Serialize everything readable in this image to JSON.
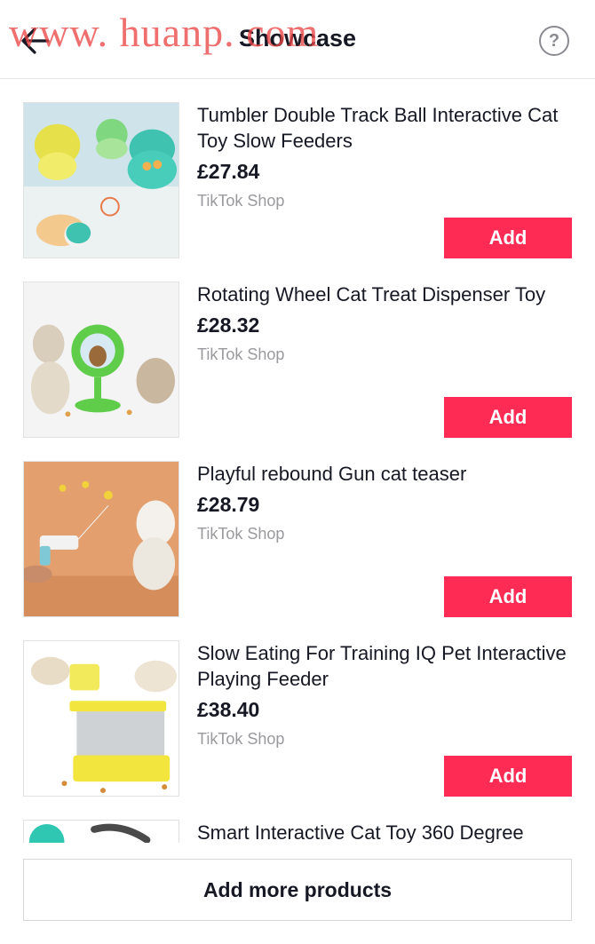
{
  "header": {
    "watermark": "www. huanp. com",
    "title": "Showcase",
    "help_icon": "question-circle-icon",
    "back_icon": "arrow-left-icon",
    "help_symbol": "?"
  },
  "products": [
    {
      "name": "Tumbler Double Track Ball Interactive Cat Toy Slow Feeders",
      "price": "£27.84",
      "shop": "TikTok Shop",
      "button": "Add"
    },
    {
      "name": "Rotating Wheel Cat Treat Dispenser Toy",
      "price": "£28.32",
      "shop": "TikTok Shop",
      "button": "Add"
    },
    {
      "name": "Playful rebound Gun cat teaser",
      "price": "£28.79",
      "shop": "TikTok Shop",
      "button": "Add"
    },
    {
      "name": "Slow Eating For Training IQ Pet Interactive Playing Feeder",
      "price": "£38.40",
      "shop": "TikTok Shop",
      "button": "Add"
    },
    {
      "name": "Smart Interactive Cat Toy 360 Degree",
      "price": "",
      "shop": "",
      "button": ""
    }
  ],
  "footer": {
    "add_more_label": "Add more products"
  },
  "colors": {
    "accent": "#fe2c55",
    "text": "#161823",
    "muted": "#9a9a9e"
  }
}
